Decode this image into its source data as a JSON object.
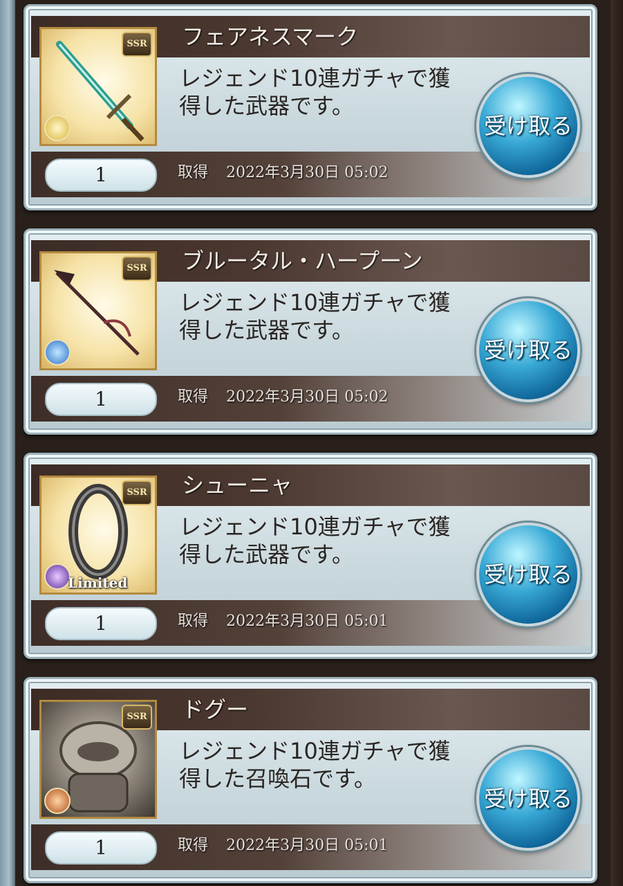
{
  "items": [
    {
      "name": "フェアネスマーク",
      "description": "レジェンド10連ガチャで獲得した武器です。",
      "count": "1",
      "acquired_label": "取得",
      "acquired_date": "2022年3月30日 05:02",
      "rarity": "SSR",
      "element": "light-icon",
      "art": "sword-icon",
      "button_label": "受け取る"
    },
    {
      "name": "ブルータル・ハープーン",
      "description": "レジェンド10連ガチャで獲得した武器です。",
      "count": "1",
      "acquired_label": "取得",
      "acquired_date": "2022年3月30日 05:02",
      "rarity": "SSR",
      "element": "water-icon",
      "art": "harpoon-icon",
      "button_label": "受け取る"
    },
    {
      "name": "シューニャ",
      "description": "レジェンド10連ガチャで獲得した武器です。",
      "count": "1",
      "acquired_label": "取得",
      "acquired_date": "2022年3月30日 05:01",
      "rarity": "SSR",
      "element": "dark-icon",
      "art": "ring-icon",
      "badge": "Limited",
      "button_label": "受け取る"
    },
    {
      "name": "ドグー",
      "description": "レジェンド10連ガチャで獲得した召喚石です。",
      "count": "1",
      "acquired_label": "取得",
      "acquired_date": "2022年3月30日 05:01",
      "rarity": "SSR",
      "element": "fire-icon",
      "art": "dogu-icon",
      "button_label": "受け取る"
    }
  ]
}
